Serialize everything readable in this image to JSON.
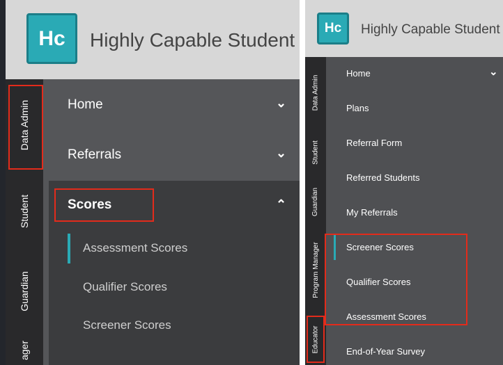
{
  "app": {
    "logo_text": "Hc",
    "title": "Highly Capable Student L"
  },
  "left_panel": {
    "rail_tabs": [
      "Data Admin",
      "Student",
      "Guardian",
      "ager"
    ],
    "menu": [
      {
        "label": "Home",
        "expanded": false
      },
      {
        "label": "Referrals",
        "expanded": false
      },
      {
        "label": "Scores",
        "expanded": true
      }
    ],
    "submenu": [
      "Assessment Scores",
      "Qualifier Scores",
      "Screener Scores"
    ],
    "active_submenu": "Assessment Scores"
  },
  "right_panel": {
    "rail_tabs": [
      "Data Admin",
      "Student",
      "Guardian",
      "Program Manager",
      "Educator"
    ],
    "menu": [
      "Home",
      "Plans",
      "Referral Form",
      "Referred Students",
      "My Referrals",
      "Screener Scores",
      "Qualifier Scores",
      "Assessment Scores",
      "End-of-Year Survey"
    ],
    "active_item": "Screener Scores"
  },
  "icons": {
    "chevron_down": "chevron-down-icon",
    "chevron_up": "chevron-up-icon"
  },
  "colors": {
    "accent": "#2aaab5",
    "highlight": "#e32b1b"
  }
}
